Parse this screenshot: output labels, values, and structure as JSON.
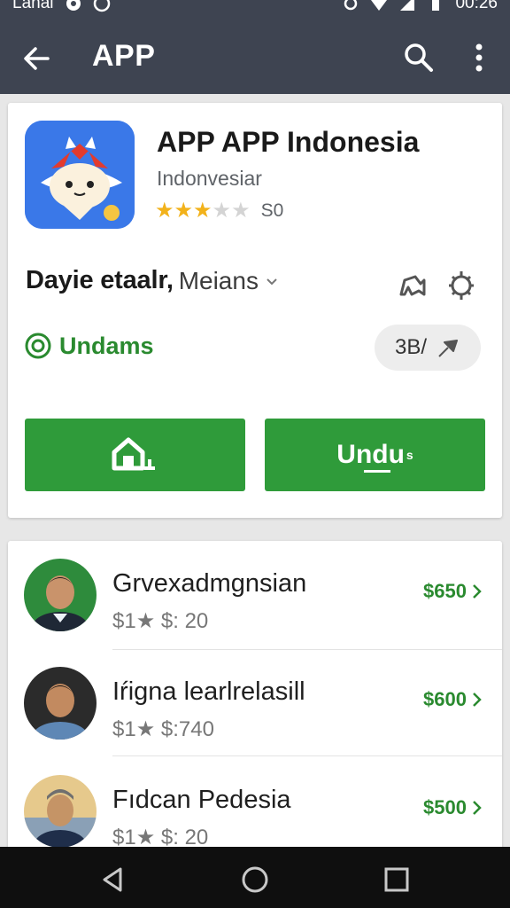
{
  "status_bar": {
    "left_text": "Lanai",
    "time": "00:26"
  },
  "toolbar": {
    "title": "APP"
  },
  "app": {
    "title": "APP APP Indonesia",
    "subtitle": "Indonvesiar",
    "rating_stars": 3,
    "rating_max": 5,
    "rating_count": "S0",
    "developer": "Dayie etaalr,",
    "category": "Meians",
    "install_status": "Undams",
    "size_label": "3B/",
    "secondary_button_label": "Undu",
    "secondary_button_suffix": "s"
  },
  "list": [
    {
      "name": "Grvexadmgnsian",
      "sub": "$1★ $: 20",
      "price": "$650"
    },
    {
      "name": "Iŕigna learlrelasill",
      "sub": "$1★ $:740",
      "price": "$600"
    },
    {
      "name": "Fıdcan Pedesia",
      "sub": "$1★ $: 20",
      "price": "$500"
    }
  ],
  "colors": {
    "toolbar": "#3e4451",
    "accent_green": "#2f9b3a",
    "star": "#f2b21b"
  }
}
